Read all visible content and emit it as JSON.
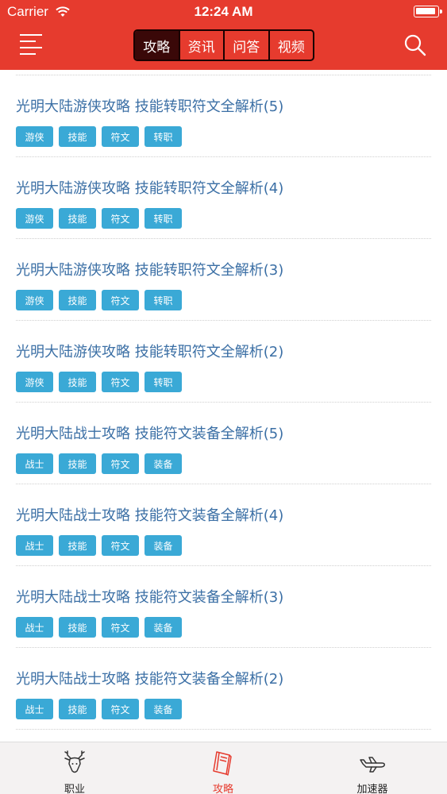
{
  "status_bar": {
    "carrier": "Carrier",
    "time": "12:24 AM"
  },
  "header": {
    "tabs": [
      {
        "label": "攻略",
        "active": true
      },
      {
        "label": "资讯",
        "active": false
      },
      {
        "label": "问答",
        "active": false
      },
      {
        "label": "视频",
        "active": false
      }
    ]
  },
  "articles": [
    {
      "title": "光明大陆游侠攻略 技能转职符文全解析(5)",
      "tags": [
        "游侠",
        "技能",
        "符文",
        "转职"
      ]
    },
    {
      "title": "光明大陆游侠攻略 技能转职符文全解析(4)",
      "tags": [
        "游侠",
        "技能",
        "符文",
        "转职"
      ]
    },
    {
      "title": "光明大陆游侠攻略 技能转职符文全解析(3)",
      "tags": [
        "游侠",
        "技能",
        "符文",
        "转职"
      ]
    },
    {
      "title": "光明大陆游侠攻略 技能转职符文全解析(2)",
      "tags": [
        "游侠",
        "技能",
        "符文",
        "转职"
      ]
    },
    {
      "title": "光明大陆战士攻略 技能符文装备全解析(5)",
      "tags": [
        "战士",
        "技能",
        "符文",
        "装备"
      ]
    },
    {
      "title": "光明大陆战士攻略 技能符文装备全解析(4)",
      "tags": [
        "战士",
        "技能",
        "符文",
        "装备"
      ]
    },
    {
      "title": "光明大陆战士攻略 技能符文装备全解析(3)",
      "tags": [
        "战士",
        "技能",
        "符文",
        "装备"
      ]
    },
    {
      "title": "光明大陆战士攻略 技能符文装备全解析(2)",
      "tags": [
        "战士",
        "技能",
        "符文",
        "装备"
      ]
    }
  ],
  "tabbar": {
    "items": [
      {
        "label": "职业",
        "icon": "deer-icon",
        "active": false
      },
      {
        "label": "攻略",
        "icon": "book-icon",
        "active": true
      },
      {
        "label": "加速器",
        "icon": "plane-icon",
        "active": false
      }
    ]
  },
  "colors": {
    "header": "#e63b2e",
    "title": "#3b6fa5",
    "tag": "#3aa9d6",
    "tab_active": "#e63b2e"
  }
}
